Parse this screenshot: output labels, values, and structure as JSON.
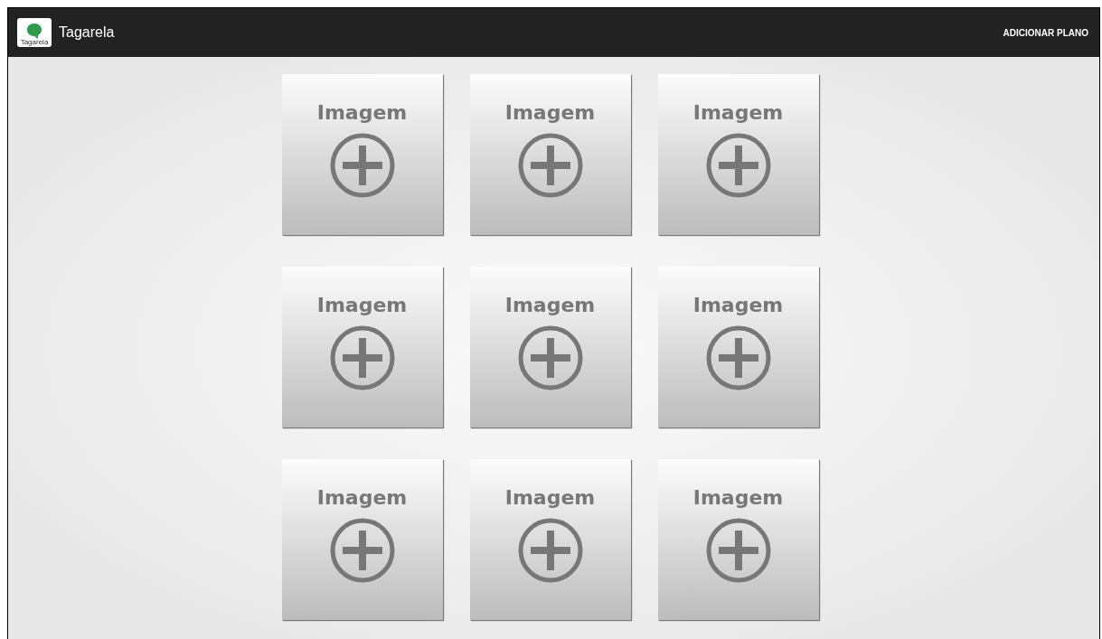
{
  "app_bar": {
    "logo_caption": "Tagarela",
    "title": "Tagarela",
    "action": "ADICIONAR PLANO"
  },
  "tiles": [
    {
      "label": "Imagem"
    },
    {
      "label": "Imagem"
    },
    {
      "label": "Imagem"
    },
    {
      "label": "Imagem"
    },
    {
      "label": "Imagem"
    },
    {
      "label": "Imagem"
    },
    {
      "label": "Imagem"
    },
    {
      "label": "Imagem"
    },
    {
      "label": "Imagem"
    }
  ]
}
